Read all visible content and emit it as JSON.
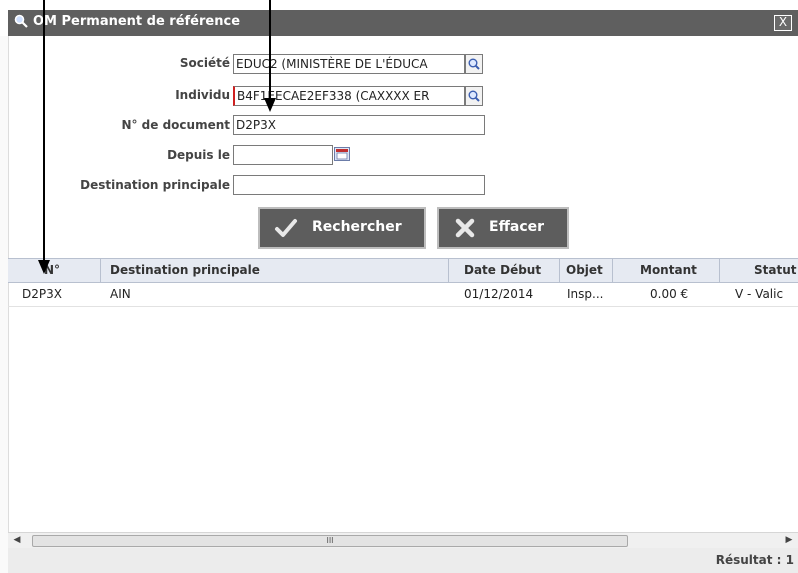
{
  "dialog": {
    "title": "OM Permanent de référence",
    "close_label": "X"
  },
  "form": {
    "societe": {
      "label": "Société",
      "value": "EDUC2 (MINISTÈRE DE L'ÉDUCA"
    },
    "individu": {
      "label": "Individu",
      "value": "B4F1EECAE2EF338 (CAXXXX ER"
    },
    "document": {
      "label": "N° de document",
      "value": "D2P3X"
    },
    "depuis": {
      "label": "Depuis le",
      "value": ""
    },
    "destination": {
      "label": "Destination principale",
      "value": ""
    }
  },
  "buttons": {
    "search": "Rechercher",
    "clear": "Effacer"
  },
  "grid": {
    "columns": [
      "N°",
      "Destination principale",
      "Date Début",
      "Objet",
      "Montant",
      "Statut"
    ],
    "rows": [
      {
        "numero": "D2P3X",
        "destination": "AIN",
        "date_debut": "01/12/2014",
        "objet": "Insp...",
        "montant": "0.00 €",
        "statut": "V - Valic"
      }
    ]
  },
  "scrollbar": {
    "grip": "III"
  },
  "footer": {
    "result": "Résultat : 1"
  },
  "colors": {
    "titlebar": "#5f5f5f",
    "header": "#e6eaf2",
    "button": "#5d5d5d",
    "required": "#d02020"
  }
}
